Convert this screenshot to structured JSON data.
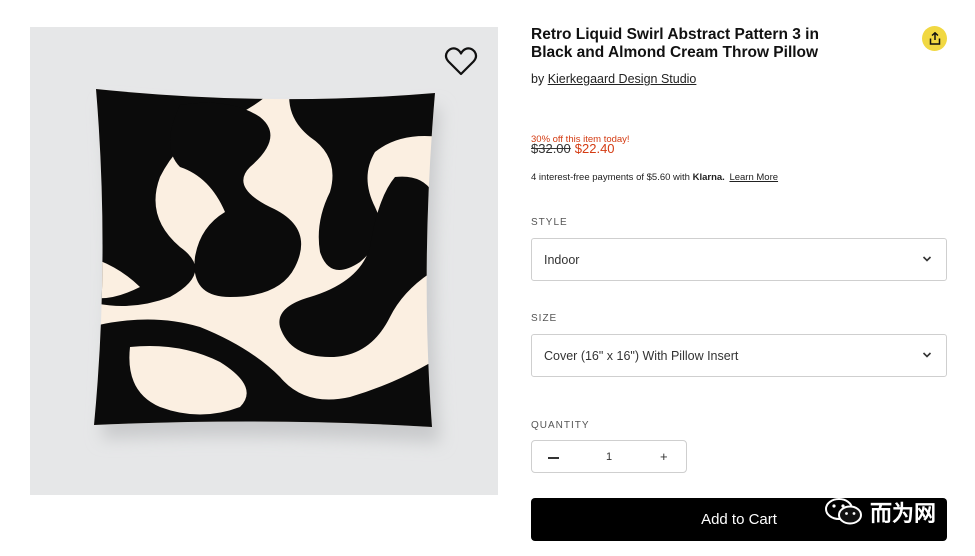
{
  "product": {
    "title": "Retro Liquid Swirl Abstract Pattern 3 in Black and Almond Cream Throw Pillow",
    "by_prefix": "by",
    "designer": "Kierkegaard Design Studio"
  },
  "pricing": {
    "promo": "30% off this item today!",
    "old_price": "$32.00",
    "new_price": "$22.40",
    "klarna_text": "4 interest-free payments of $5.60 with",
    "klarna_brand": "Klarna.",
    "klarna_link": "Learn More"
  },
  "style": {
    "label": "STYLE",
    "value": "Indoor"
  },
  "size": {
    "label": "SIZE",
    "value": "Cover (16\" x 16\") With Pillow Insert"
  },
  "quantity": {
    "label": "QUANTITY",
    "value": "1",
    "minus": "—",
    "plus": "+"
  },
  "cart": {
    "label": "Add to Cart"
  },
  "watermark": {
    "text": "而为网"
  },
  "colors": {
    "accent_price": "#d43b12",
    "share_button": "#f1d842",
    "pillow_black": "#0b0b0b",
    "pillow_cream": "#fbefe1",
    "image_background": "#e6e7e8",
    "cart_button": "#000000"
  },
  "icons": {
    "wishlist": "heart-outline-icon",
    "share": "share-icon",
    "dropdown": "chevron-down-icon"
  }
}
